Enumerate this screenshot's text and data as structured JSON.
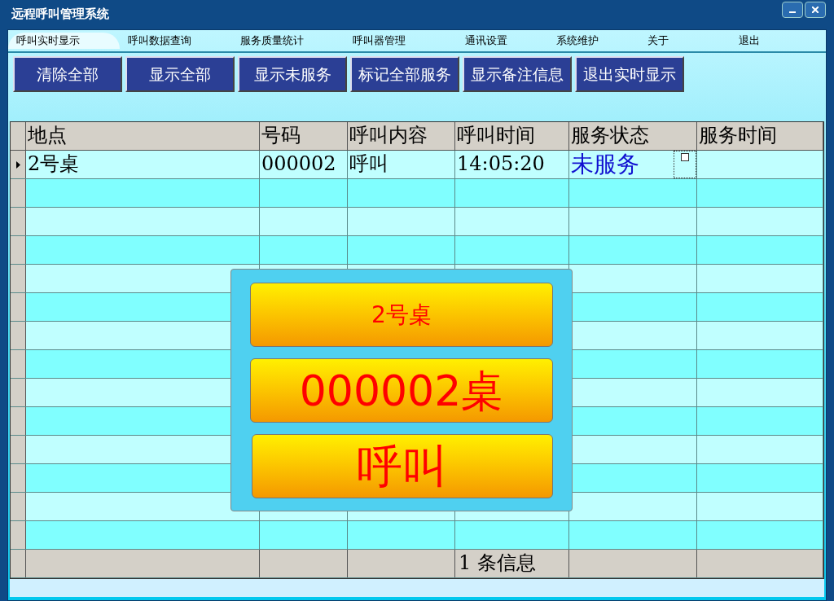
{
  "window": {
    "title": "远程呼叫管理系统"
  },
  "menu": [
    {
      "label": "呼叫实时显示",
      "selected": true
    },
    {
      "label": "呼叫数据查询",
      "selected": false
    },
    {
      "label": "服务质量统计",
      "selected": false
    },
    {
      "label": "呼叫器管理",
      "selected": false
    },
    {
      "label": "通讯设置",
      "selected": false
    },
    {
      "label": "系统维护",
      "selected": false
    },
    {
      "label": "关于",
      "selected": false
    },
    {
      "label": "退出",
      "selected": false
    }
  ],
  "toolbar": [
    "清除全部",
    "显示全部",
    "显示未服务",
    "标记全部服务",
    "显示备注信息",
    "退出实时显示"
  ],
  "table": {
    "columns": [
      "地点",
      "号码",
      "呼叫内容",
      "呼叫时间",
      "服务状态",
      "服务时间"
    ],
    "rows": [
      {
        "selected": true,
        "cells": [
          "2号桌",
          "000002",
          "呼叫",
          "14:05:20",
          "未服务",
          ""
        ],
        "checked": false
      }
    ],
    "footer": {
      "column_4": "1 条信息"
    }
  },
  "popup": {
    "location": "2号桌",
    "number": "000002桌",
    "content": "呼叫"
  }
}
